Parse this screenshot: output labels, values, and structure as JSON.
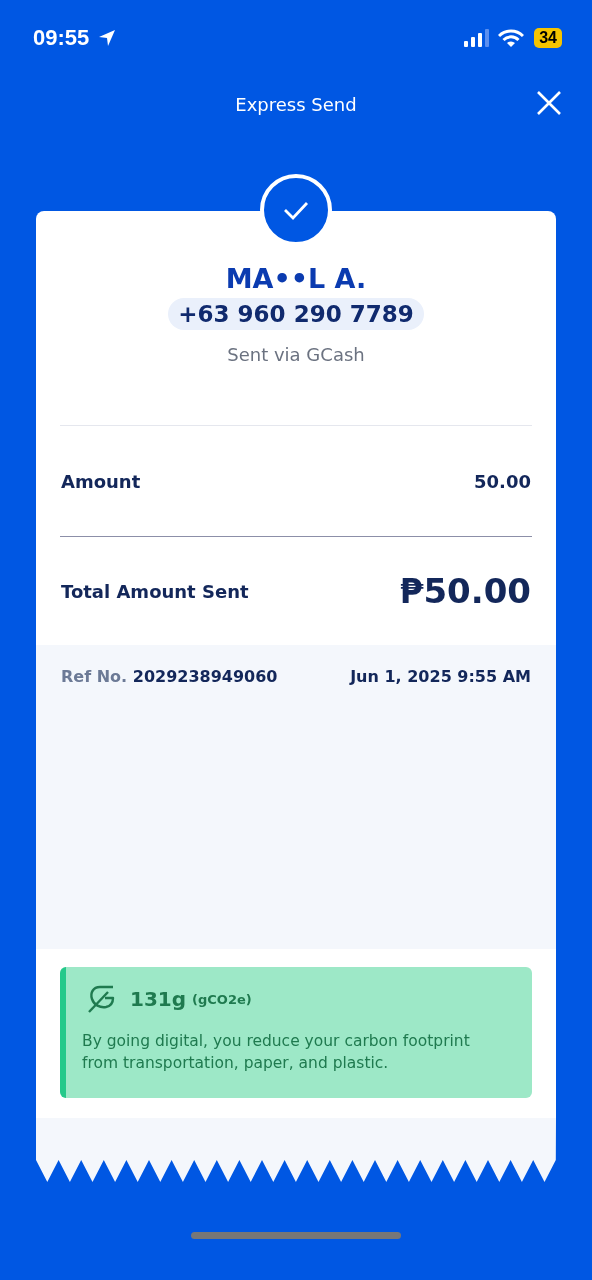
{
  "status_bar": {
    "time": "09:55",
    "battery": "34"
  },
  "header": {
    "title": "Express Send"
  },
  "recipient": {
    "name": "MA••L A.",
    "phone": "+63 960 290 7789",
    "via": "Sent via GCash"
  },
  "amount": {
    "label": "Amount",
    "value": "50.00"
  },
  "total": {
    "label": "Total Amount Sent",
    "value": "₱50.00"
  },
  "reference": {
    "label": "Ref No.",
    "number": "2029238949060",
    "date": "Jun 1, 2025 9:55 AM"
  },
  "eco": {
    "amount": "131g",
    "unit": "(gCO2e)",
    "message": "By going digital, you reduce your carbon footprint from transportation, paper, and plastic."
  }
}
